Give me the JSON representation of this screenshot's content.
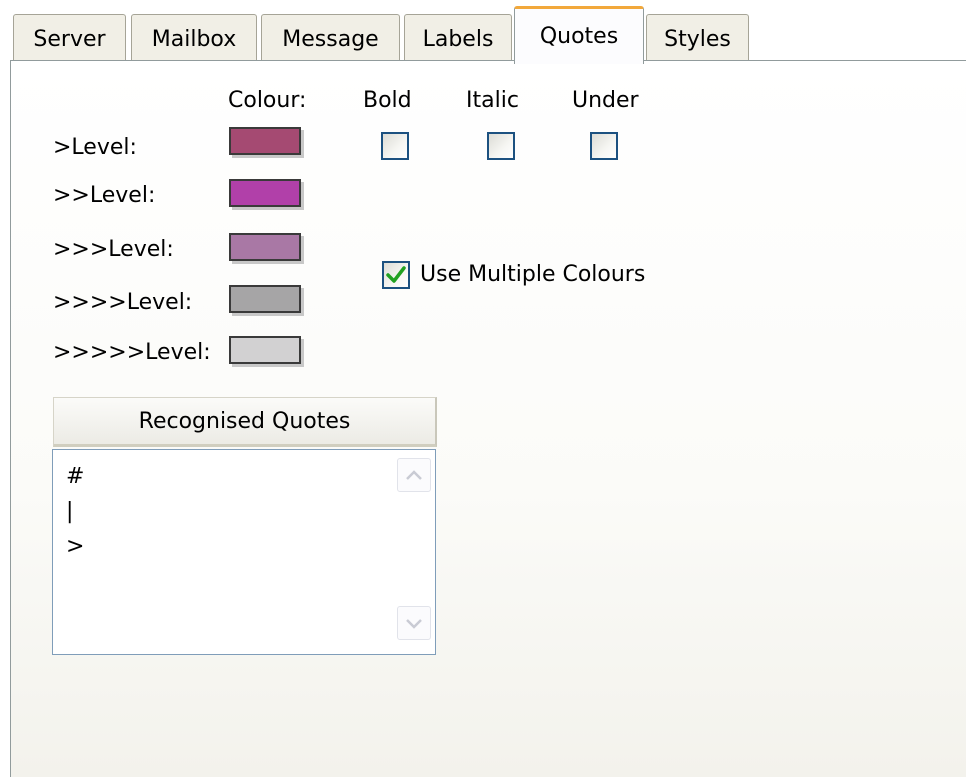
{
  "tabs": [
    {
      "label": "Server",
      "active": false
    },
    {
      "label": "Mailbox",
      "active": false
    },
    {
      "label": "Message",
      "active": false
    },
    {
      "label": "Labels",
      "active": false
    },
    {
      "label": "Quotes",
      "active": true
    },
    {
      "label": "Styles",
      "active": false
    }
  ],
  "columns": {
    "colour": "Colour:",
    "bold": "Bold",
    "italic": "Italic",
    "under": "Under"
  },
  "levels": [
    {
      "label": ">Level:",
      "colour": "#a54a72"
    },
    {
      "label": ">>Level:",
      "colour": "#b140a9"
    },
    {
      "label": ">>>Level:",
      "colour": "#a978a5"
    },
    {
      "label": ">>>>Level:",
      "colour": "#a6a5a6"
    },
    {
      "label": ">>>>>Level:",
      "colour": "#d2d1d2"
    }
  ],
  "styles": {
    "bold": false,
    "italic": false,
    "under": false
  },
  "multiple_colours": {
    "label": "Use Multiple Colours",
    "checked": true
  },
  "recognised_quotes": {
    "header": "Recognised Quotes",
    "items": [
      "#",
      "|",
      ">"
    ]
  },
  "colors": {
    "active_tab_accent": "#f2a83b",
    "checkbox_border": "#1c5180",
    "check_mark": "#21a121",
    "list_border": "#7f9db9"
  }
}
